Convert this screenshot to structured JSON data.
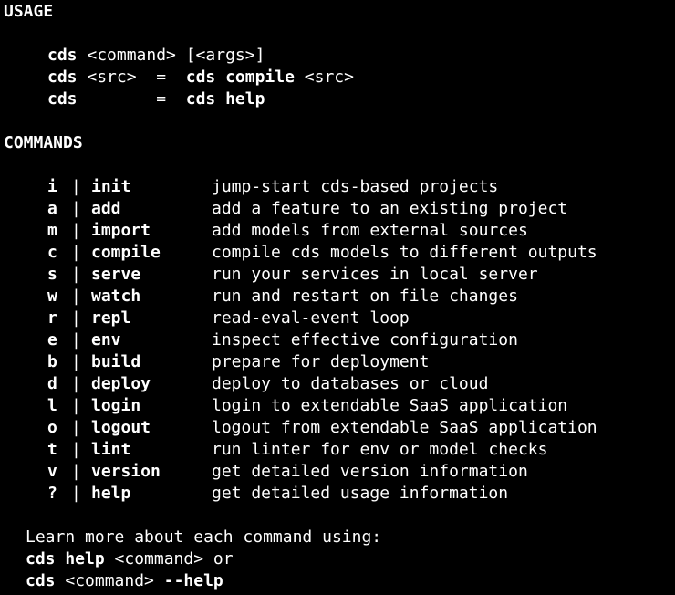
{
  "usage": {
    "heading": "USAGE",
    "lines": [
      {
        "cmd": "cds",
        "arg": " <command> [<args>]"
      },
      {
        "cmd": "cds",
        "arg": " <src>  =  ",
        "cmd2": "cds compile",
        "arg2": " <src>"
      },
      {
        "cmd": "cds",
        "arg": "        =  ",
        "cmd2": "cds help",
        "arg2": ""
      }
    ]
  },
  "commands": {
    "heading": "COMMANDS",
    "items": [
      {
        "short": "i",
        "name": "init",
        "desc": "jump-start cds-based projects"
      },
      {
        "short": "a",
        "name": "add",
        "desc": "add a feature to an existing project"
      },
      {
        "short": "m",
        "name": "import",
        "desc": "add models from external sources"
      },
      {
        "short": "c",
        "name": "compile",
        "desc": "compile cds models to different outputs"
      },
      {
        "short": "s",
        "name": "serve",
        "desc": "run your services in local server"
      },
      {
        "short": "w",
        "name": "watch",
        "desc": "run and restart on file changes"
      },
      {
        "short": "r",
        "name": "repl",
        "desc": "read-eval-event loop"
      },
      {
        "short": "e",
        "name": "env",
        "desc": "inspect effective configuration"
      },
      {
        "short": "b",
        "name": "build",
        "desc": "prepare for deployment"
      },
      {
        "short": "d",
        "name": "deploy",
        "desc": "deploy to databases or cloud"
      },
      {
        "short": "l",
        "name": "login",
        "desc": "login to extendable SaaS application"
      },
      {
        "short": "o",
        "name": "logout",
        "desc": "logout from extendable SaaS application"
      },
      {
        "short": "t",
        "name": "lint",
        "desc": "run linter for env or model checks"
      },
      {
        "short": "v",
        "name": "version",
        "desc": "get detailed version information"
      },
      {
        "short": "?",
        "name": "help",
        "desc": "get detailed usage information"
      }
    ],
    "separator": "|"
  },
  "footer": {
    "intro": "Learn more about each command using:",
    "line1": {
      "cmd": "cds help",
      "arg": " <command> or"
    },
    "line2": {
      "cmd": "cds",
      "arg": " <command> ",
      "cmd2": "--help"
    }
  }
}
